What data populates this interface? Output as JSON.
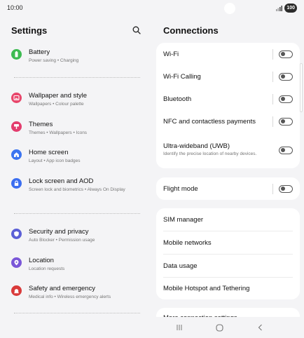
{
  "status_bar": {
    "time": "10:00",
    "battery": "100"
  },
  "left": {
    "title": "Settings",
    "items": [
      {
        "title": "Battery",
        "subtitle": "Power saving • Charging",
        "icon": "battery-icon",
        "color": "#3dbb52"
      },
      {
        "title": "Wallpaper and style",
        "subtitle": "Wallpapers • Colour palette",
        "icon": "palette-icon",
        "color": "#e8466b"
      },
      {
        "title": "Themes",
        "subtitle": "Themes • Wallpapers • Icons",
        "icon": "themes-icon",
        "color": "#e33d6e"
      },
      {
        "title": "Home screen",
        "subtitle": "Layout • App icon badges",
        "icon": "home-icon",
        "color": "#3b74f0"
      },
      {
        "title": "Lock screen and AOD",
        "subtitle": "Screen lock and biometrics • Always On Display",
        "icon": "lock-icon",
        "color": "#3b6ef0"
      },
      {
        "title": "Security and privacy",
        "subtitle": "Auto Blocker • Permission usage",
        "icon": "shield-icon",
        "color": "#5b5fd6"
      },
      {
        "title": "Location",
        "subtitle": "Location requests",
        "icon": "location-icon",
        "color": "#7a56d8"
      },
      {
        "title": "Safety and emergency",
        "subtitle": "Medical info • Wireless emergency alerts",
        "icon": "emergency-icon",
        "color": "#d93a3a"
      }
    ]
  },
  "right": {
    "title": "Connections",
    "card1": [
      {
        "label": "Wi-Fi"
      },
      {
        "label": "Wi-Fi Calling"
      },
      {
        "label": "Bluetooth"
      },
      {
        "label": "NFC and contactless payments"
      },
      {
        "label": "Ultra-wideband (UWB)",
        "sub": "Identify the precise location of nearby devices."
      }
    ],
    "flight_mode": "Flight mode",
    "card3": [
      "SIM manager",
      "Mobile networks",
      "Data usage",
      "Mobile Hotspot and Tethering"
    ],
    "more": "More connection settings"
  }
}
